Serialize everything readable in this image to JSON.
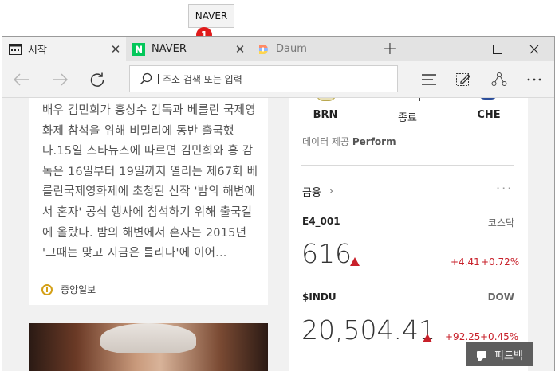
{
  "tooltip": {
    "text": "NAVER"
  },
  "badge": {
    "text": "1"
  },
  "colors": {
    "accent_red": "#e01b1b",
    "stock_up": "#c8202a",
    "naver_green": "#03c75a"
  },
  "tabs": [
    {
      "label": "시작",
      "icon": "start-icon",
      "active": true
    },
    {
      "label": "NAVER",
      "icon": "naver-n-icon",
      "active": false
    },
    {
      "label": "Daum",
      "icon": "daum-d-icon",
      "active": false
    }
  ],
  "toolbar": {
    "address_placeholder": "주소 검색 또는 입력"
  },
  "news": {
    "body": "배우 김민희가 홍상수 감독과 베를린 국제영화제 참석을 위해 비밀리에 동반 출국했다.15일 스타뉴스에 따르면 김민희와 홍 감독은 16일부터 19일까지 열리는 제67회 베를린국제영화제에 초청된 신작 '밤의 해변에서 혼자' 공식 행사에 참석하기 위해 출국길에 올랐다. 밤의 해변에서 혼자는 2015년 '그때는 맞고 지금은 틀리다'에 이어...",
    "source": "중앙일보"
  },
  "sports": {
    "team_left": "BRN",
    "team_mid": "종료",
    "team_right": "CHE",
    "provider_prefix": "데이터 제공",
    "provider_name": "Perform"
  },
  "finance": {
    "title": "금융",
    "more": "···",
    "stocks": [
      {
        "symbol": "E4_001",
        "market": "코스닥",
        "price": "616",
        "change": "+4.41",
        "pct": "+0.72%"
      },
      {
        "symbol": "$INDU",
        "market": "DOW",
        "price": "20,504.41",
        "change": "+92.25",
        "pct": "+0.45%"
      }
    ]
  },
  "feedback": {
    "label": "피드백"
  }
}
